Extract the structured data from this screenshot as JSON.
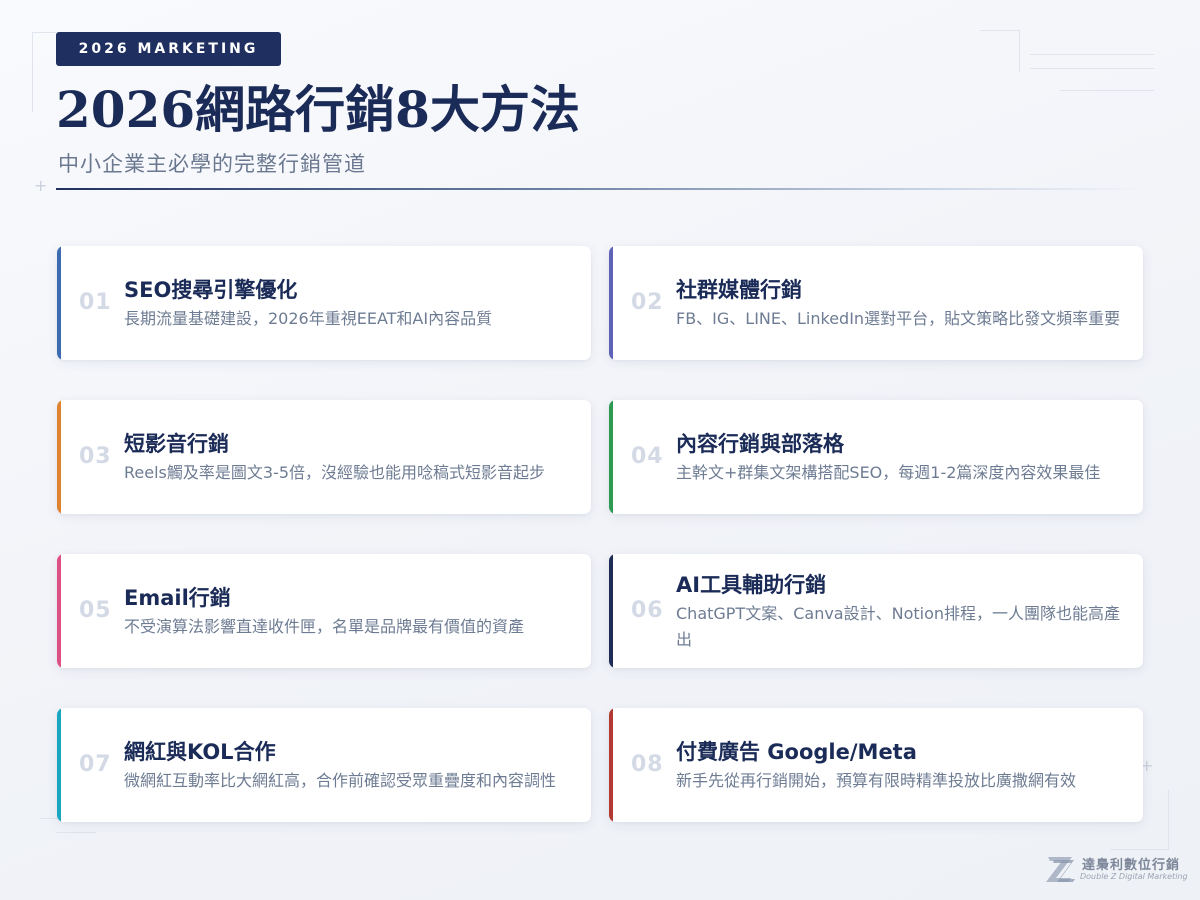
{
  "header": {
    "badge": "2026 MARKETING",
    "title": "2026網路行銷8大方法",
    "subtitle": "中小企業主必學的完整行銷管道"
  },
  "cards": [
    {
      "number": "01",
      "title": "SEO搜尋引擎優化",
      "description": "長期流量基礎建設，2026年重視EEAT和AI內容品質",
      "accent": "#3d6bb0"
    },
    {
      "number": "02",
      "title": "社群媒體行銷",
      "description": "FB、IG、LINE、LinkedIn選對平台，貼文策略比發文頻率重要",
      "accent": "#5e63b8"
    },
    {
      "number": "03",
      "title": "短影音行銷",
      "description": "Reels觸及率是圖文3-5倍，沒經驗也能用唸稿式短影音起步",
      "accent": "#e08331"
    },
    {
      "number": "04",
      "title": "內容行銷與部落格",
      "description": "主幹文+群集文架構搭配SEO，每週1-2篇深度內容效果最佳",
      "accent": "#2c9a50"
    },
    {
      "number": "05",
      "title": "Email行銷",
      "description": "不受演算法影響直達收件匣，名單是品牌最有價值的資產",
      "accent": "#de4f86"
    },
    {
      "number": "06",
      "title": "AI工具輔助行銷",
      "description": "ChatGPT文案、Canva設計、Notion排程，一人團隊也能高產出",
      "accent": "#1f2d56"
    },
    {
      "number": "07",
      "title": "網紅與KOL合作",
      "description": "微網紅互動率比大網紅高，合作前確認受眾重疊度和內容調性",
      "accent": "#1aa6bf"
    },
    {
      "number": "08",
      "title": "付費廣告 Google/Meta",
      "description": "新手先從再行銷開始，預算有限時精準投放比廣撒網有效",
      "accent": "#b23a33"
    }
  ],
  "logo": {
    "name": "達梟利數位行銷",
    "tagline": "Double Z Digital Marketing",
    "icon": "double-z-logo-icon"
  }
}
